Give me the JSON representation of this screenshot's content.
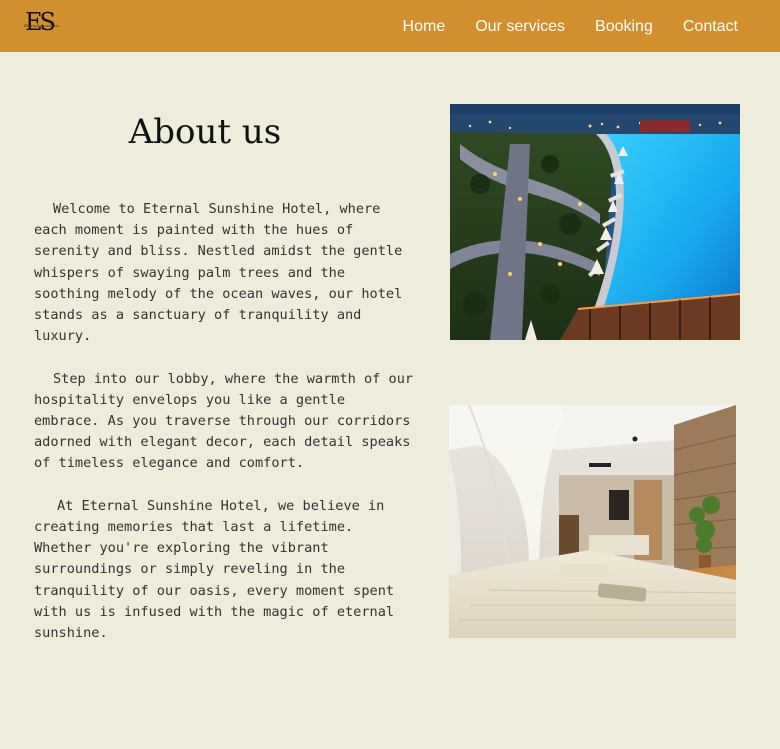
{
  "header": {
    "logo": {
      "letters": "ES",
      "script": "Eternal Sunshine",
      "icon": "hotel-logo-icon"
    },
    "nav": [
      {
        "label": "Home"
      },
      {
        "label": "Our services"
      },
      {
        "label": "Booking"
      },
      {
        "label": "Contact"
      }
    ],
    "colors": {
      "bar": "#d28f2d",
      "link": "#ffffff",
      "page_bg": "#eeecda"
    }
  },
  "about": {
    "title": "About us",
    "paragraphs": [
      "Welcome to Eternal Sunshine Hotel, where each moment is painted with the hues of serenity and bliss. Nestled amidst the gentle whispers of swaying palm trees and the soothing melody of the ocean waves, our hotel stands as a sanctuary of tranquility and luxury.",
      "Step into our lobby, where the warmth of our hospitality envelops you like a gentle embrace. As you traverse through our corridors adorned with elegant decor, each detail speaks of timeless elegance and comfort.",
      "At Eternal Sunshine Hotel, we believe in creating memories that last a lifetime. Whether you're exploring the vibrant surroundings or simply reveling in the tranquility of our oasis, every moment spent with us is infused with the magic of eternal sunshine."
    ]
  },
  "images": [
    {
      "subject": "resort-pool-night",
      "icon": "photo-pool"
    },
    {
      "subject": "hotel-bedroom",
      "icon": "photo-bedroom"
    }
  ]
}
